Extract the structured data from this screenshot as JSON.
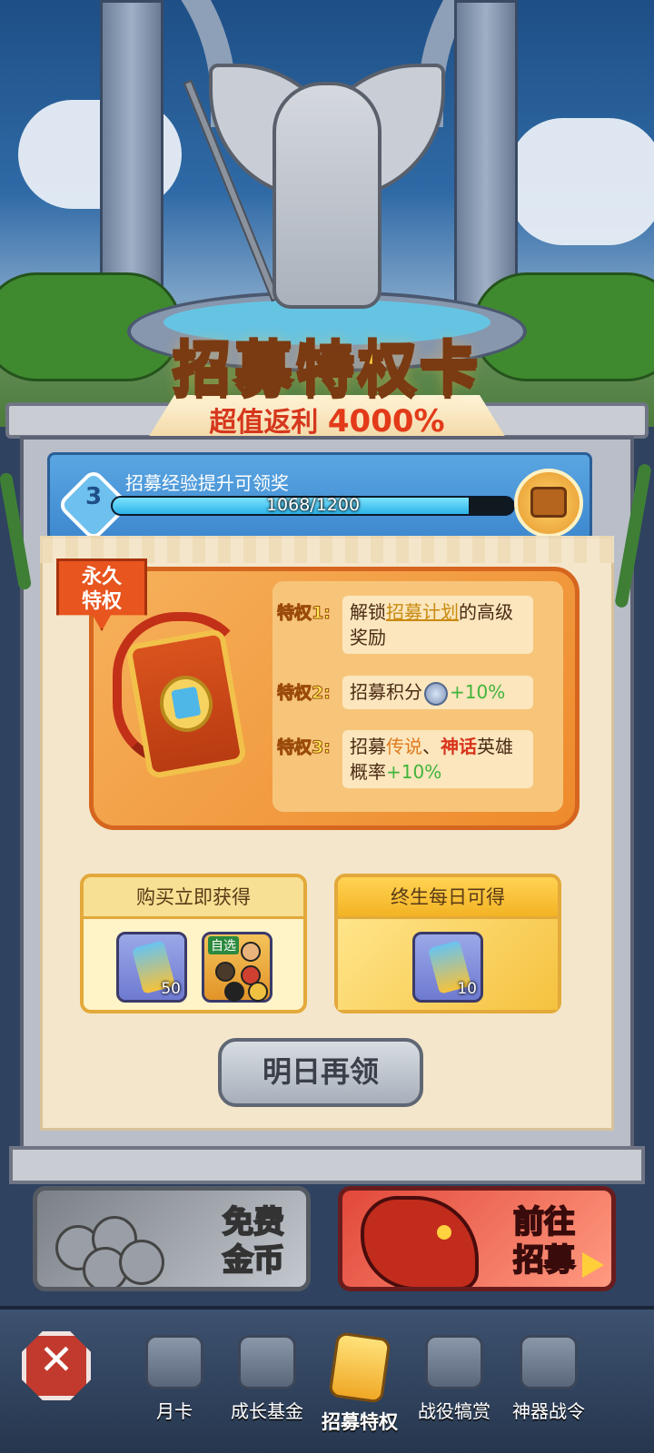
{
  "header": {
    "title": "招募特权卡",
    "subtitle_prefix": "超值返利",
    "subtitle_value": "4000%"
  },
  "progress": {
    "level": "3",
    "label": "招募经验提升可领奖",
    "current": 1068,
    "max": 1200,
    "text": "1068/1200"
  },
  "privilege_card": {
    "tag": "永久特权",
    "privileges": [
      {
        "label": "特权1:",
        "parts": [
          "解锁",
          "招募计划",
          "的高级奖励"
        ]
      },
      {
        "label": "特权2:",
        "parts": [
          "招募积分",
          "+10%"
        ]
      },
      {
        "label": "特权3:",
        "parts": [
          "招募",
          "传说",
          "、",
          "神话",
          "英雄概率",
          "+10%"
        ]
      }
    ]
  },
  "rewards": {
    "instant": {
      "title": "购买立即获得",
      "items": [
        {
          "icon": "recruit-ticket-icon",
          "count": "50"
        },
        {
          "icon": "hero-choice-icon",
          "tag": "自选"
        }
      ]
    },
    "daily": {
      "title": "终生每日可得",
      "items": [
        {
          "icon": "recruit-ticket-icon",
          "count": "10"
        }
      ]
    }
  },
  "claim_button": "明日再领",
  "promos": {
    "free_gold": {
      "line1": "免费",
      "line2": "金币"
    },
    "go_recruit": {
      "line1": "前往",
      "line2": "招募"
    }
  },
  "tabs": [
    {
      "label": "月卡",
      "icon": "month-card-icon",
      "active": false
    },
    {
      "label": "成长基金",
      "icon": "growth-fund-icon",
      "active": false
    },
    {
      "label": "招募特权",
      "icon": "recruit-privilege-icon",
      "active": true
    },
    {
      "label": "战役犒赏",
      "icon": "campaign-reward-icon",
      "active": false
    },
    {
      "label": "神器战令",
      "icon": "artifact-pass-icon",
      "active": false
    }
  ],
  "colors": {
    "title_gold": "#ffcf3a",
    "subtitle_red": "#d6371d",
    "progress_fill": "#2bb3e7",
    "highlight_green": "#41b43b",
    "highlight_red": "#d8321b"
  }
}
